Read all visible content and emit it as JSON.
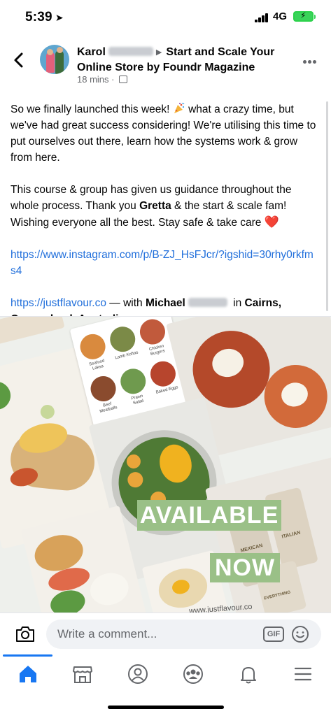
{
  "status_bar": {
    "time": "5:39",
    "location_glyph": "➤",
    "network": "4G"
  },
  "header": {
    "author": "Karol",
    "group": "Start and Scale Your Online Store by Foundr Magazine",
    "time_ago": "18 mins",
    "separator": "·"
  },
  "post": {
    "p1_a": "So we finally launched this week! ",
    "p1_b": " what a crazy time, but we've had great success considering! We're utilising this time to put ourselves out there, learn how the systems work & grow from here.",
    "p2_a": "This course & group has given us guidance throughout the whole process. Thank you ",
    "p2_bold": "Gretta",
    "p2_b": " & the start & scale fam! Wishing everyone all the best. Stay safe & take care ",
    "heart": "❤️",
    "link1": "https://www.instagram.com/p/B-ZJ_HsFJcr/?igshid=30rhy0rkfms4",
    "link2": "https://justflavour.co",
    "with_text": " — with ",
    "tagged": "Michael",
    "in_text": " in ",
    "place": "Cairns, Queensland, Australia",
    "end": "."
  },
  "image": {
    "badge_available": "AVAILABLE",
    "badge_now": "NOW",
    "recipe_labels": [
      "Seafood Laksa",
      "Lamb Koftas",
      "Chicken Burgers",
      "Beef Meatballs",
      "Prawn Salad",
      "Baked Eggs"
    ],
    "watermark": "www.justflavour.co",
    "product_labels": [
      "MEXICAN",
      "EVERYTHING",
      "ITALIAN"
    ],
    "colors": {
      "badge": "#9ac087"
    }
  },
  "comment_bar": {
    "placeholder": "Write a comment...",
    "gif_label": "GIF"
  },
  "tabs": [
    {
      "name": "home",
      "icon": "home-icon",
      "active": true
    },
    {
      "name": "marketplace",
      "icon": "marketplace-icon"
    },
    {
      "name": "profile",
      "icon": "profile-icon"
    },
    {
      "name": "groups",
      "icon": "groups-icon"
    },
    {
      "name": "notifications",
      "icon": "bell-icon"
    },
    {
      "name": "menu",
      "icon": "menu-icon"
    }
  ],
  "colors": {
    "link": "#216fdb",
    "accent": "#1877f2",
    "secondary_text": "#65676b"
  }
}
